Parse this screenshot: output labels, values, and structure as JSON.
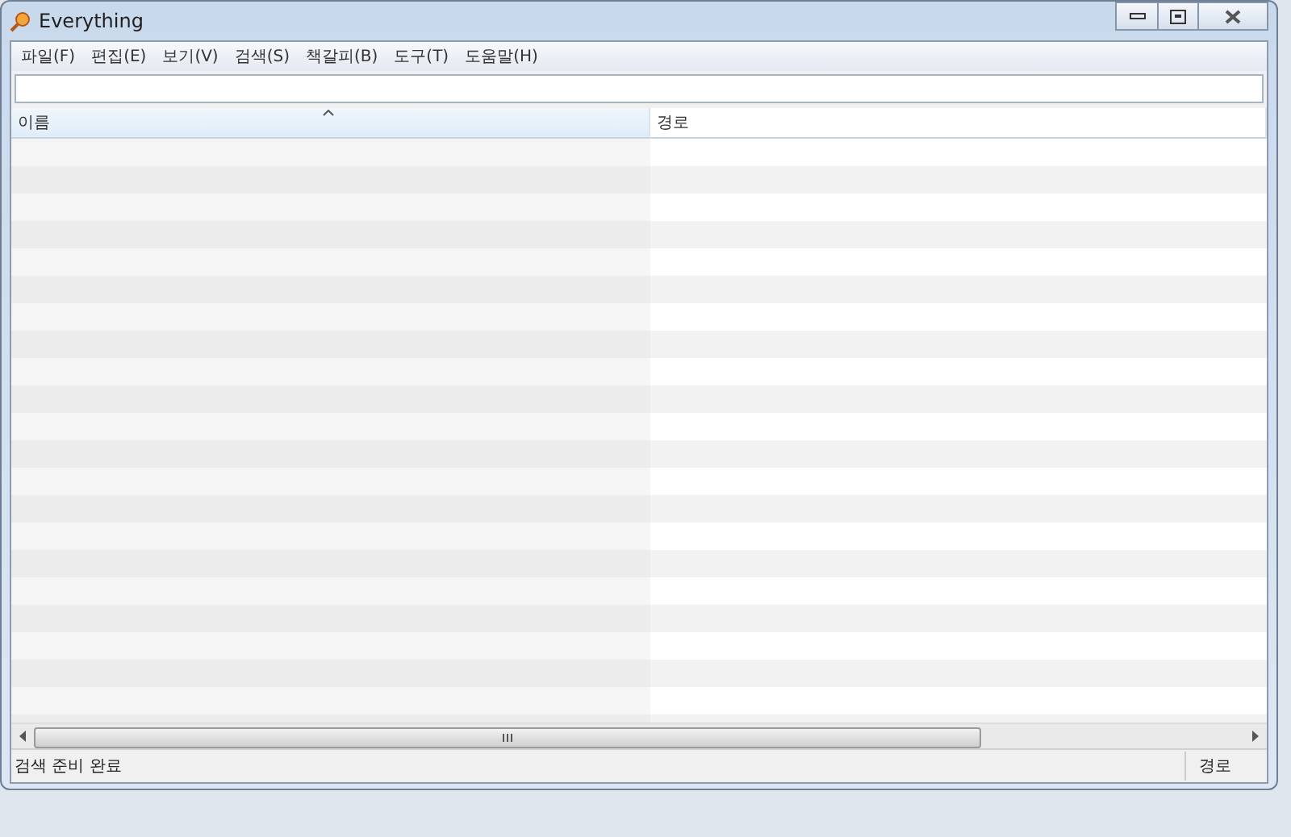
{
  "window": {
    "title": "Everything"
  },
  "menu": [
    "파일(F)",
    "편집(E)",
    "보기(V)",
    "검색(S)",
    "책갈피(B)",
    "도구(T)",
    "도움말(H)"
  ],
  "table": {
    "columns": [
      {
        "label": "이름",
        "sorted": true
      },
      {
        "label": "경로",
        "sorted": false
      }
    ]
  },
  "status_bar": {
    "message": "검색 준비 완료",
    "column": "경로"
  }
}
